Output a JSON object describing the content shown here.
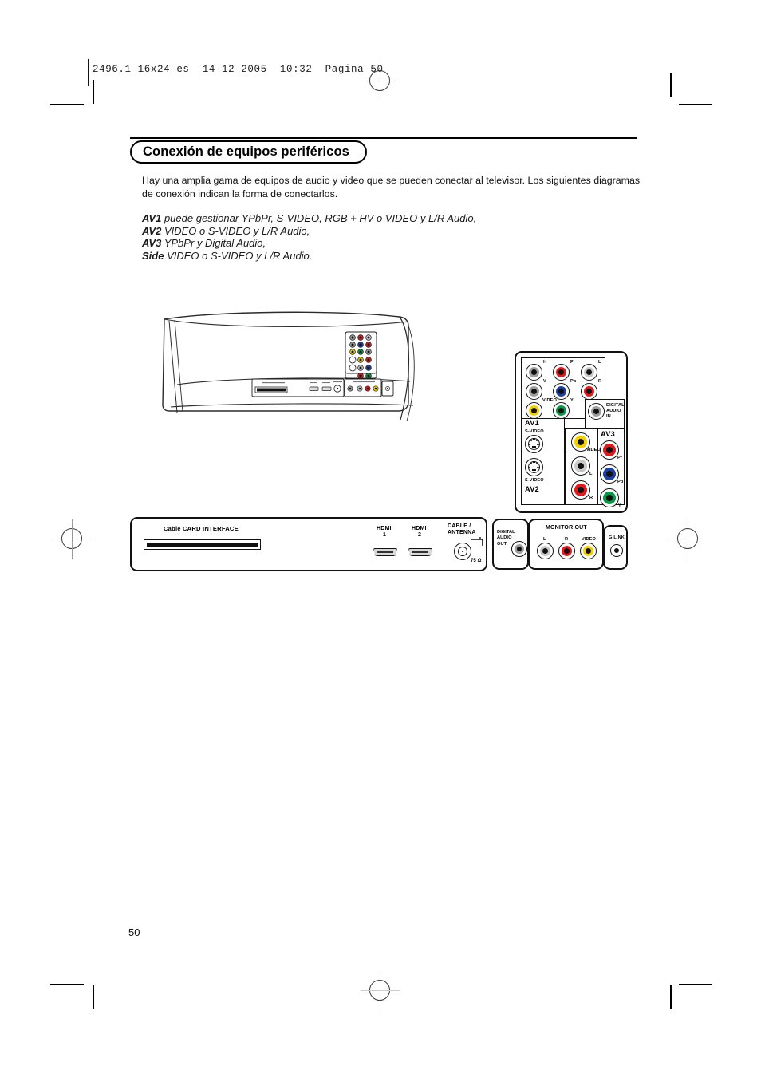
{
  "slug": {
    "text": "2496.1 16x24 es  14-12-2005  10:32  Pagina 50"
  },
  "header": {
    "title": "Conexión de equipos periféricos"
  },
  "intro": {
    "paragraph": "Hay una amplia gama de equipos de audio y video que se pueden conectar al televisor. Los siguientes diagramas de conexión indican la forma de conectarlos."
  },
  "av_list": [
    {
      "name": "AV1",
      "desc": "puede gestionar YPbPr, S-VIDEO, RGB + HV o VIDEO y L/R Audio,"
    },
    {
      "name": "AV2",
      "desc": "VIDEO o S-VIDEO y L/R Audio,"
    },
    {
      "name": "AV3",
      "desc": "YPbPr y Digital Audio,"
    },
    {
      "name": "Side",
      "desc": "VIDEO o S-VIDEO y L/R Audio."
    }
  ],
  "footer": {
    "page_number": "50"
  },
  "colors": {
    "red": "#e3191c",
    "blue": "#1d3fa8",
    "green": "#009b44",
    "yellow": "#f5d000",
    "gray": "#9d9d9d",
    "white_gray": "#c9c9c9",
    "black": "#111111"
  },
  "rear_panel": {
    "name": "AV1-AV2-AV3 connector block",
    "groups": [
      {
        "name": "AV1",
        "label": "AV1",
        "jacks": [
          {
            "label": "H",
            "color": "gray"
          },
          {
            "label": "Pr",
            "color": "red"
          },
          {
            "label": "L",
            "color": "white_gray"
          },
          {
            "label": "V",
            "color": "gray"
          },
          {
            "label": "Pb",
            "color": "blue"
          },
          {
            "label": "R",
            "color": "red"
          },
          {
            "label": "VIDEO",
            "color": "yellow"
          },
          {
            "label": "Y",
            "color": "green"
          }
        ],
        "svideo_label": "S-VIDEO"
      },
      {
        "name": "AV2",
        "label": "AV2",
        "svideo_label": "S-VIDEO",
        "jacks": [
          {
            "label": "VIDEO",
            "color": "yellow"
          },
          {
            "label": "L",
            "color": "white_gray"
          },
          {
            "label": "R",
            "color": "red"
          }
        ]
      },
      {
        "name": "AV3",
        "label": "AV3",
        "digital_audio_in": [
          "DIGITAL",
          "AUDIO",
          "IN"
        ],
        "jacks": [
          {
            "label": "Pr",
            "color": "red"
          },
          {
            "label": "Pb",
            "color": "blue"
          },
          {
            "label": "Y",
            "color": "green"
          }
        ]
      }
    ]
  },
  "bottom_panel": {
    "cable_card": {
      "label": "Cable CARD INTERFACE"
    },
    "hdmi": [
      {
        "label": "HDMI",
        "number": "1"
      },
      {
        "label": "HDMI",
        "number": "2"
      }
    ],
    "cable_antenna": {
      "line1": "CABLE /",
      "line2": "ANTENNA",
      "impedance": "75 Ω"
    },
    "digital_audio_out": [
      "DIGITAL",
      "AUDIO",
      "OUT"
    ],
    "monitor_out": {
      "title": "MONITOR OUT",
      "jacks": [
        {
          "label": "L",
          "color": "white_gray"
        },
        {
          "label": "R",
          "color": "red"
        },
        {
          "label": "VIDEO",
          "color": "yellow"
        }
      ]
    },
    "glink": {
      "label": "G-LINK"
    }
  }
}
